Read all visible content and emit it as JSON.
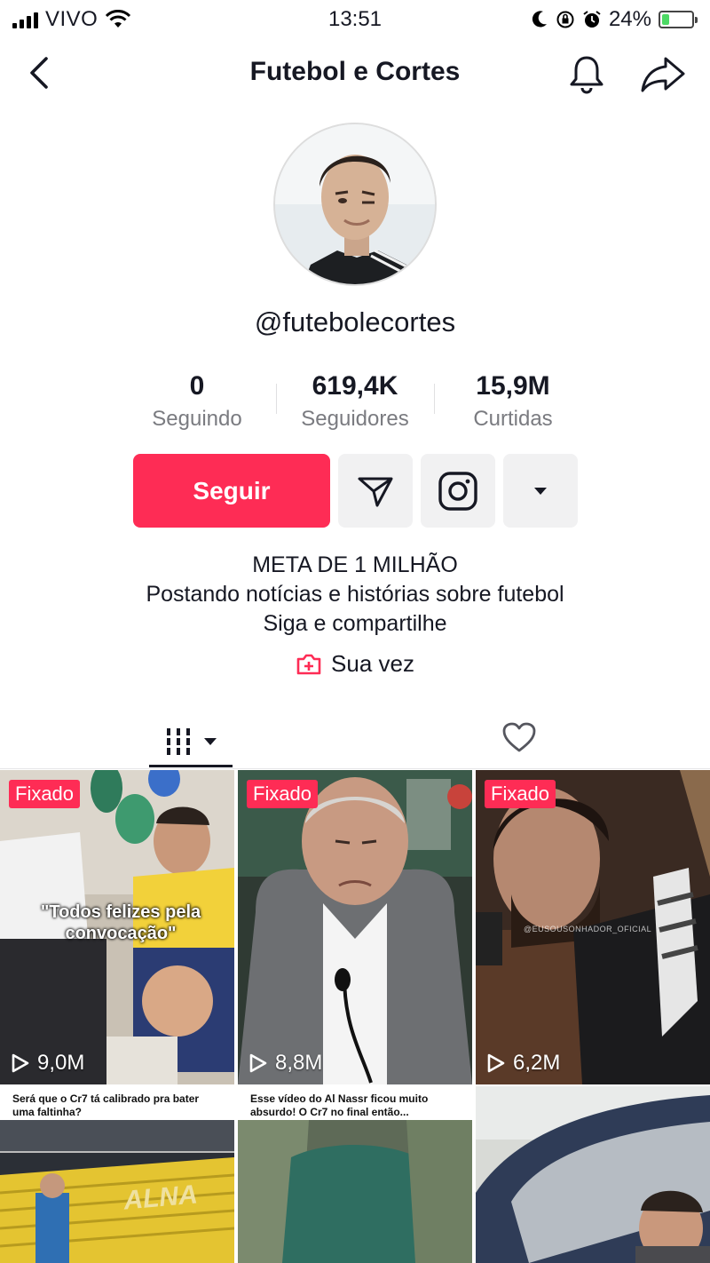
{
  "status_bar": {
    "carrier": "VIVO",
    "time": "13:51",
    "battery": "24%",
    "battery_level": 0.24
  },
  "nav": {
    "title": "Futebol e Cortes"
  },
  "profile": {
    "username": "@futebolecortes",
    "stats": [
      {
        "value": "0",
        "label": "Seguindo"
      },
      {
        "value": "619,4K",
        "label": "Seguidores"
      },
      {
        "value": "15,9M",
        "label": "Curtidas"
      }
    ],
    "follow_label": "Seguir",
    "bio": [
      "META DE 1 MILHÃO",
      "Postando notícias e histórias sobre futebol",
      "Siga e compartilhe"
    ],
    "link_label": "Sua vez"
  },
  "colors": {
    "accent": "#fe2c55",
    "button_gray": "#f1f1f2"
  },
  "videos": [
    {
      "pinned": "Fixado",
      "views": "9,0M",
      "overlay": "\"Todos felizes pela convocação\""
    },
    {
      "pinned": "Fixado",
      "views": "8,8M"
    },
    {
      "pinned": "Fixado",
      "views": "6,2M",
      "watermark": "@EUSOUSONHADOR_OFICIAL"
    },
    {
      "caption": "Será que o Cr7 tá calibrado pra bater uma faltinha?",
      "scene_text": "ALNA"
    },
    {
      "caption": "Esse vídeo do Al Nassr ficou muito absurdo! O Cr7 no final então..."
    },
    {}
  ]
}
